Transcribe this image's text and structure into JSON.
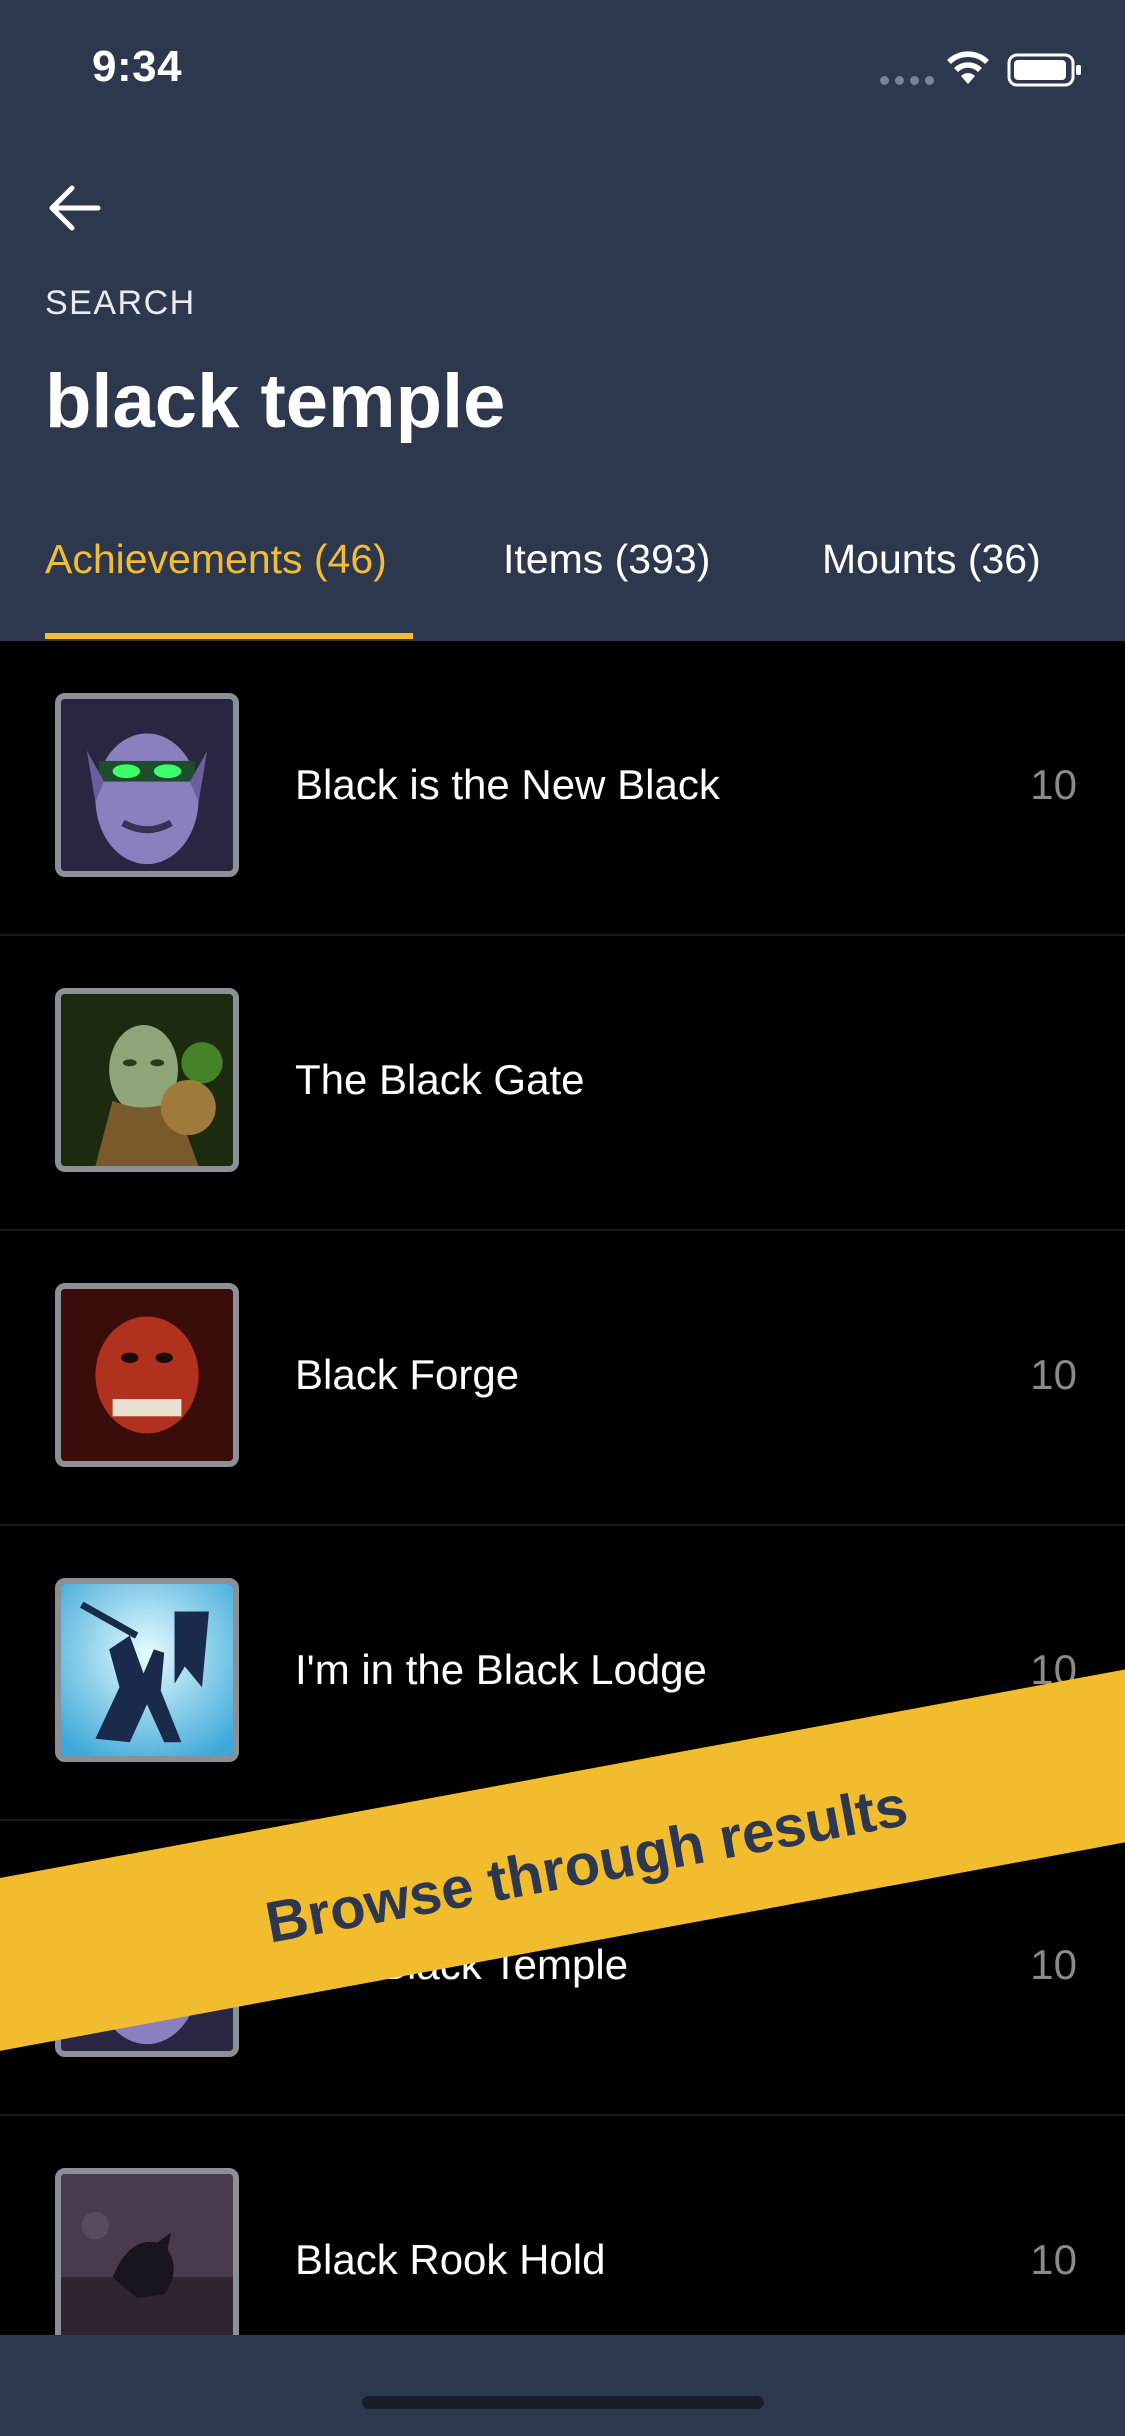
{
  "status_bar": {
    "time": "9:34"
  },
  "header": {
    "search_label": "SEARCH",
    "title": "black temple"
  },
  "tabs": [
    {
      "label": "Achievements (46)",
      "active": true
    },
    {
      "label": "Items (393)",
      "active": false
    },
    {
      "label": "Mounts (36)",
      "active": false
    }
  ],
  "results": [
    {
      "title": "Black is the New Black",
      "points": "10",
      "icon": "illidan-portrait-icon"
    },
    {
      "title": "The Black Gate",
      "points": "",
      "icon": "akama-portrait-icon"
    },
    {
      "title": "Black Forge",
      "points": "10",
      "icon": "orc-portrait-icon"
    },
    {
      "title": "I'm in the Black Lodge",
      "points": "10",
      "icon": "silhouette-banner-icon"
    },
    {
      "title": "The Black Temple",
      "points": "10",
      "icon": "illidan-portrait-icon"
    },
    {
      "title": "Black Rook Hold",
      "points": "10",
      "icon": "raven-icon"
    }
  ],
  "banner": {
    "text": "Browse through results"
  },
  "colors": {
    "header_bg": "#2d374e",
    "accent": "#f2bc33",
    "list_bg": "#000000"
  }
}
